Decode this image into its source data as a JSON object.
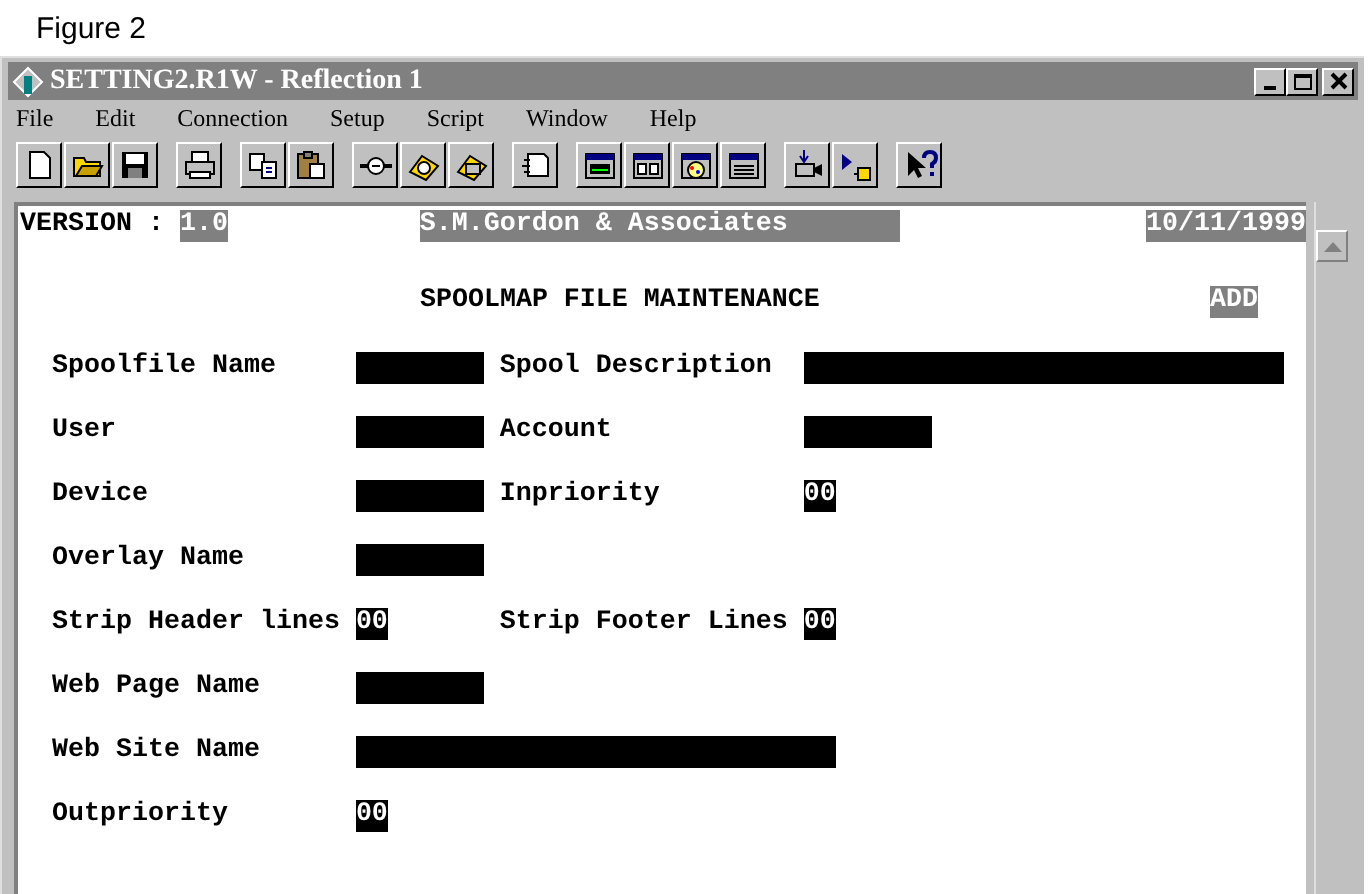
{
  "figure_caption": "Figure 2",
  "window": {
    "title": "SETTING2.R1W - Reflection 1"
  },
  "menu": [
    {
      "label": "File"
    },
    {
      "label": "Edit"
    },
    {
      "label": "Connection"
    },
    {
      "label": "Setup"
    },
    {
      "label": "Script"
    },
    {
      "label": "Window"
    },
    {
      "label": "Help"
    }
  ],
  "terminal": {
    "header": {
      "label": "VERSION :",
      "version": "1.0",
      "company": "S.M.Gordon & Associates",
      "date": "10/11/1999"
    },
    "screen_title": "SPOOLMAP FILE MAINTENANCE",
    "mode": "ADD",
    "rows": [
      {
        "fields": [
          {
            "label": "Spoolfile Name",
            "kind": "short"
          },
          {
            "label": "Spool Description",
            "kind": "long"
          }
        ]
      },
      {
        "fields": [
          {
            "label": "User",
            "kind": "short"
          },
          {
            "label": "Account",
            "kind": "short"
          }
        ]
      },
      {
        "fields": [
          {
            "label": "Device",
            "kind": "short"
          },
          {
            "label": "Inpriority",
            "kind": "number",
            "value": "00"
          }
        ]
      },
      {
        "fields": [
          {
            "label": "Overlay Name",
            "kind": "short"
          }
        ]
      },
      {
        "fields": [
          {
            "label": "Strip Header lines",
            "kind": "number",
            "value": "00"
          },
          {
            "label": "Strip Footer Lines",
            "kind": "number",
            "value": "00"
          }
        ]
      },
      {
        "fields": [
          {
            "label": "Web Page Name",
            "kind": "short"
          }
        ]
      },
      {
        "fields": [
          {
            "label": "Web Site Name",
            "kind": "long"
          }
        ]
      },
      {
        "fields": [
          {
            "label": "Outpriority",
            "kind": "number",
            "value": "00"
          }
        ]
      }
    ]
  }
}
